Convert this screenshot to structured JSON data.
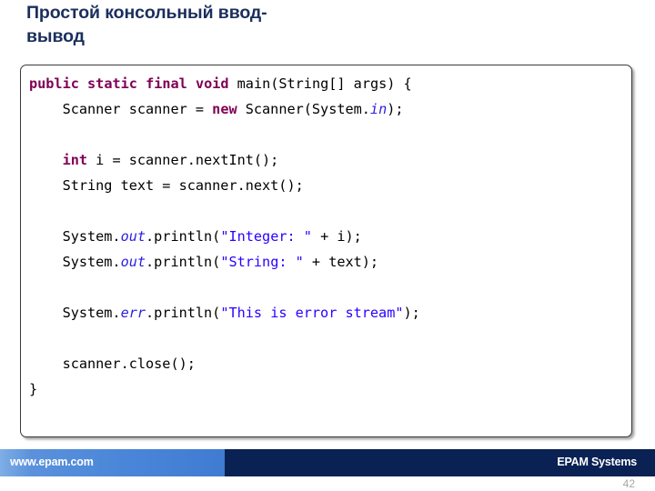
{
  "slide": {
    "title": "Простой консольный ввод-\nвывод",
    "page_number": "42"
  },
  "code_box": {
    "language": "java",
    "lines": [
      {
        "tokens": [
          {
            "t": "public",
            "c": "kw"
          },
          {
            "t": " ",
            "c": "pln"
          },
          {
            "t": "static",
            "c": "kw"
          },
          {
            "t": " ",
            "c": "pln"
          },
          {
            "t": "final",
            "c": "kw"
          },
          {
            "t": " ",
            "c": "pln"
          },
          {
            "t": "void",
            "c": "kw"
          },
          {
            "t": " main(String[] args) {",
            "c": "pln"
          }
        ]
      },
      {
        "tokens": [
          {
            "t": "    Scanner scanner = ",
            "c": "pln"
          },
          {
            "t": "new",
            "c": "kw"
          },
          {
            "t": " Scanner(System.",
            "c": "pln"
          },
          {
            "t": "in",
            "c": "fld"
          },
          {
            "t": ");",
            "c": "pln"
          }
        ]
      },
      {
        "tokens": [
          {
            "t": "",
            "c": "pln"
          }
        ]
      },
      {
        "tokens": [
          {
            "t": "    ",
            "c": "pln"
          },
          {
            "t": "int",
            "c": "kw"
          },
          {
            "t": " i = scanner.nextInt();",
            "c": "pln"
          }
        ]
      },
      {
        "tokens": [
          {
            "t": "    String text = scanner.next();",
            "c": "pln"
          }
        ]
      },
      {
        "tokens": [
          {
            "t": "",
            "c": "pln"
          }
        ]
      },
      {
        "tokens": [
          {
            "t": "    System.",
            "c": "pln"
          },
          {
            "t": "out",
            "c": "fld"
          },
          {
            "t": ".println(",
            "c": "pln"
          },
          {
            "t": "\"Integer: \"",
            "c": "str"
          },
          {
            "t": " + i);",
            "c": "pln"
          }
        ]
      },
      {
        "tokens": [
          {
            "t": "    System.",
            "c": "pln"
          },
          {
            "t": "out",
            "c": "fld"
          },
          {
            "t": ".println(",
            "c": "pln"
          },
          {
            "t": "\"String: \"",
            "c": "str"
          },
          {
            "t": " + text);",
            "c": "pln"
          }
        ]
      },
      {
        "tokens": [
          {
            "t": "",
            "c": "pln"
          }
        ]
      },
      {
        "tokens": [
          {
            "t": "    System.",
            "c": "pln"
          },
          {
            "t": "err",
            "c": "fld"
          },
          {
            "t": ".println(",
            "c": "pln"
          },
          {
            "t": "\"This is error stream\"",
            "c": "str"
          },
          {
            "t": ");",
            "c": "pln"
          }
        ]
      },
      {
        "tokens": [
          {
            "t": "",
            "c": "pln"
          }
        ]
      },
      {
        "tokens": [
          {
            "t": "    scanner.close();",
            "c": "pln"
          }
        ]
      },
      {
        "tokens": [
          {
            "t": "}",
            "c": "pln"
          }
        ]
      }
    ]
  },
  "footer": {
    "url": "www.epam.com",
    "brand": "EPAM Systems",
    "left_color": "#4a86d8",
    "right_color": "#0a2154"
  },
  "colors": {
    "title": "#1b2f5c",
    "keyword": "#7f0055",
    "field": "#2a1fe0",
    "string": "#2a00ff",
    "plain": "#000000"
  }
}
